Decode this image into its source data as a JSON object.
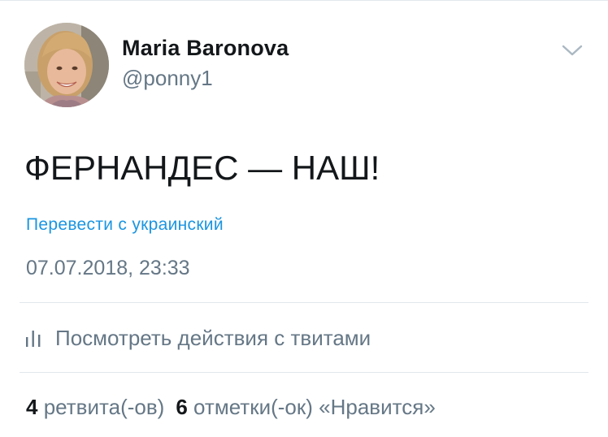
{
  "tweet": {
    "author": {
      "display_name": "Maria Baronova",
      "handle": "@ponny1"
    },
    "text": "ФЕРНАНДЕС — НАШ!",
    "translate_label": "Перевести с украинский",
    "timestamp": "07.07.2018, 23:33",
    "activity_label": "Посмотреть действия с твитами",
    "stats": {
      "retweets_count": "4",
      "retweets_label": "ретвита(-ов)",
      "likes_count": "6",
      "likes_label": "отметки(-ок) «Нравится»"
    }
  },
  "icons": {
    "menu": "chevron-down-icon",
    "activity": "bar-chart-icon"
  },
  "colors": {
    "text_primary": "#14171a",
    "text_secondary": "#657786",
    "link": "#1b95e0",
    "divider": "#e1e8ed"
  }
}
